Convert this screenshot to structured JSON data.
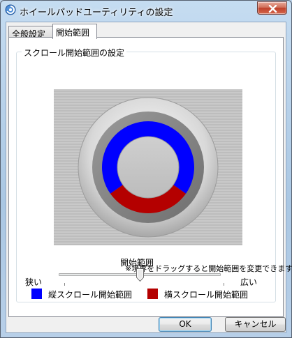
{
  "window": {
    "title": "ホイールパッドユーティリティの設定"
  },
  "tabs": [
    {
      "label": "全般設定",
      "active": false
    },
    {
      "label": "開始範囲",
      "active": true
    }
  ],
  "group": {
    "label": "スクロール開始範囲の設定"
  },
  "preview": {
    "vertical_color": "#0000ff",
    "horizontal_color": "#b40000"
  },
  "note": "※境界をドラッグすると開始範囲を変更できます",
  "legend": [
    {
      "label": "縦スクロール開始範囲",
      "color": "#0000ff"
    },
    {
      "label": "横スクロール開始範囲",
      "color": "#b40000"
    }
  ],
  "slider": {
    "title": "開始範囲",
    "min_label": "狭い",
    "max_label": "広い"
  },
  "buttons": {
    "ok": "OK",
    "cancel": "キャンセル"
  }
}
